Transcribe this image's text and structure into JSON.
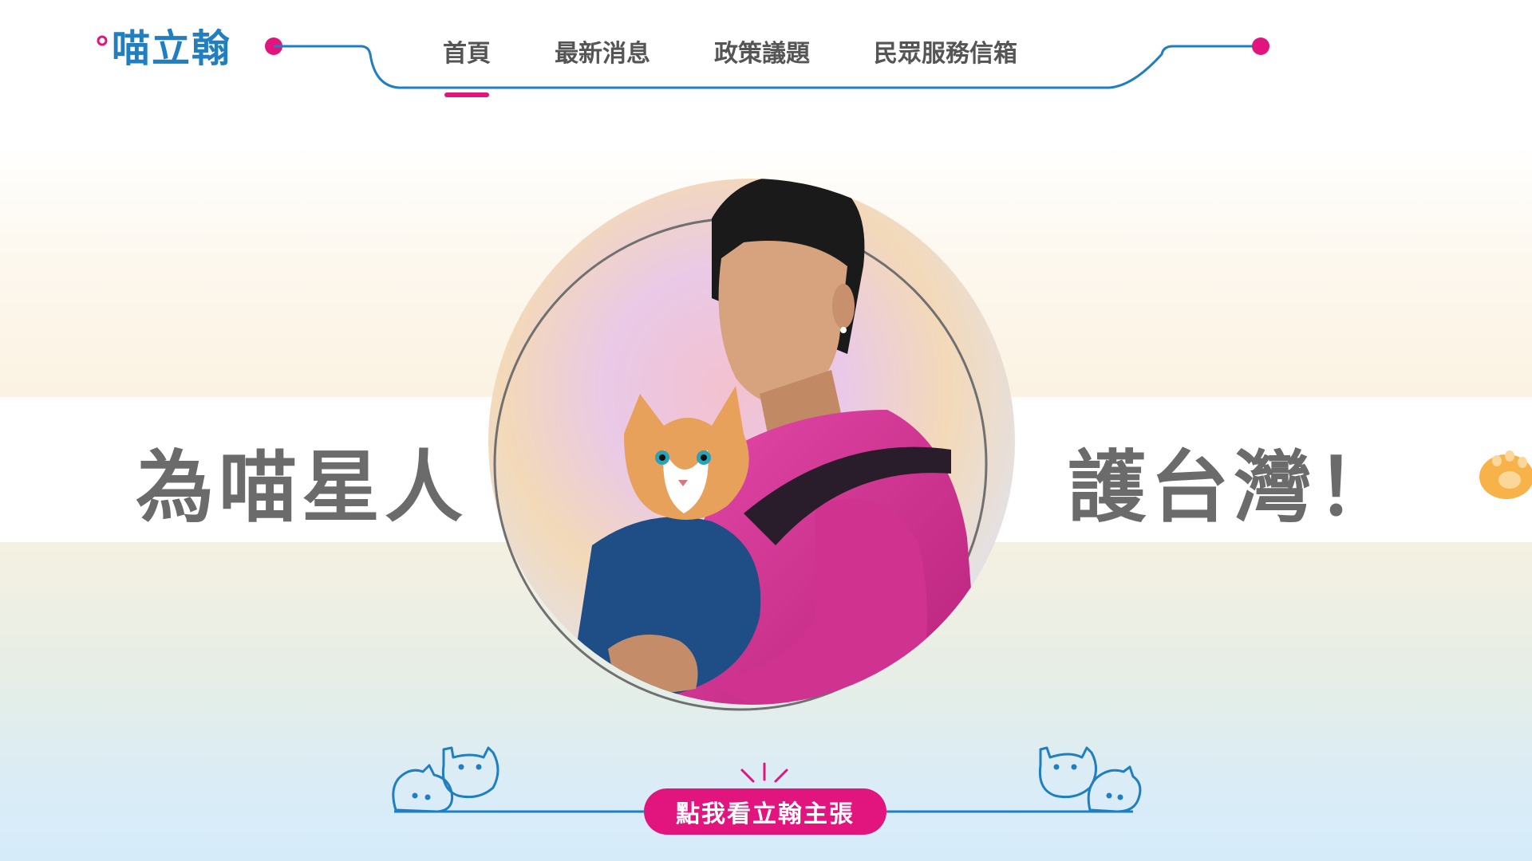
{
  "brand": {
    "logo_text": "喵立翰"
  },
  "nav": {
    "items": [
      {
        "label": "首頁",
        "active": true
      },
      {
        "label": "最新消息",
        "active": false
      },
      {
        "label": "政策議題",
        "active": false
      },
      {
        "label": "民眾服務信箱",
        "active": false
      }
    ]
  },
  "hero": {
    "left_text": "為喵星人",
    "right_text": "護台灣！"
  },
  "cta": {
    "label": "點我看立翰主張"
  },
  "colors": {
    "accent_pink": "#e2157e",
    "accent_blue": "#1f7fc0",
    "text_gray": "#6b6b6b"
  },
  "icons": [
    "logo-cat-ears",
    "paw-icon",
    "cat-doodle-left-icon",
    "cat-doodle-right-icon",
    "sparkle-icon"
  ]
}
